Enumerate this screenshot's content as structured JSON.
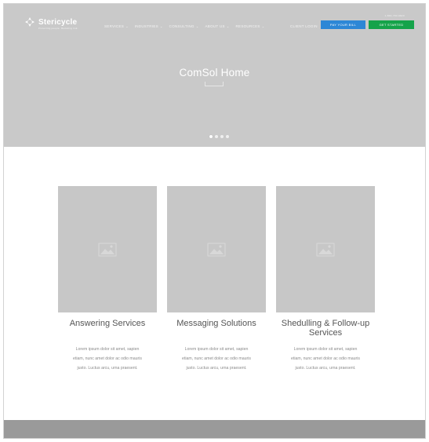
{
  "brand": {
    "name": "Stericycle",
    "tagline": "Protecting people. Reducing risk."
  },
  "top_links": "1-866-783-9820",
  "nav": {
    "items": [
      {
        "label": "SERVICES"
      },
      {
        "label": "INDUSTRIES"
      },
      {
        "label": "CONSULTING"
      },
      {
        "label": "ABOUT US"
      },
      {
        "label": "RESOURCES"
      }
    ],
    "client_login": "CLIENT LOGIN",
    "pay_bill": "PAY YOUR BILL",
    "get_started": "GET STARTED"
  },
  "hero": {
    "title": "ComSol Home",
    "slides": 4,
    "active_slide": 1
  },
  "cards": [
    {
      "title": "Answering Services",
      "desc": [
        "Lorem ipsum dolor sit amet, sapien",
        "etiam, nunc amet dolor ac odio mauris",
        "justo. Luctus arcu, urna praesent."
      ]
    },
    {
      "title": "Messaging Solutions",
      "desc": [
        "Lorem ipsum dolor sit amet, sapien",
        "etiam, nunc amet dolor ac odio mauris",
        "justo. Luctus arcu, urna praesent."
      ]
    },
    {
      "title_lines": [
        "Shedulling & Follow-up",
        "Services"
      ],
      "desc": [
        "Lorem ipsum dolor sit amet, sapien",
        "etiam, nunc amet dolor ac odio mauris",
        "justo. Luctus arcu, urna praesent."
      ]
    }
  ],
  "colors": {
    "hero_bg": "#c9c9c9",
    "pay_button": "#2d87d6",
    "start_button": "#15a34a",
    "footer_bg": "#9a9a9a"
  }
}
